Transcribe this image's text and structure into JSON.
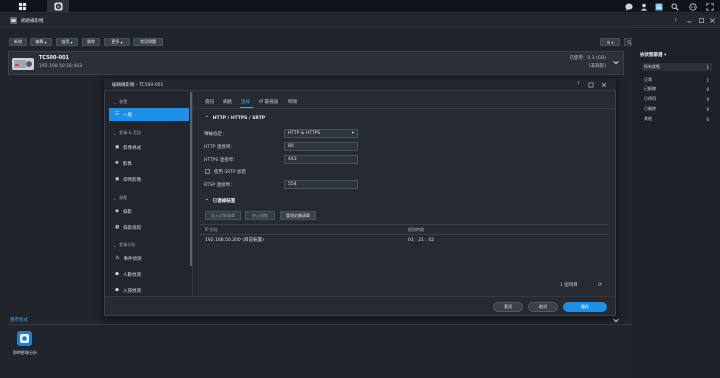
{
  "window": {
    "title": "網路攝影機"
  },
  "toolbar": {
    "buttons": [
      "新增",
      "編輯",
      "啟用",
      "刪除",
      "更多",
      "常見問題"
    ],
    "search_placeholder": "搜尋"
  },
  "camera": {
    "name": "TC500-001",
    "address": "192.168.50.16:443",
    "usage": "已使用：0.3 (GB)",
    "mode": "[非錄影]"
  },
  "right_panel": {
    "title": "依狀態篩選",
    "items": [
      {
        "label": "所有狀態",
        "count": "1"
      },
      {
        "label": "正常",
        "count": "1"
      },
      {
        "label": "已斷線",
        "count": "0"
      },
      {
        "label": "已停用",
        "count": "0"
      },
      {
        "label": "已刪除",
        "count": "0"
      },
      {
        "label": "其他",
        "count": "0"
      }
    ]
  },
  "apps": {
    "section_title": "應用程式",
    "app_label": "即時影像分析"
  },
  "dialog": {
    "title": "編輯攝影機 - TC500-001",
    "sidebar": {
      "cat1": "裝置",
      "item_general": "一般",
      "cat2": "影像 & 音訊",
      "item_format": "影像格式",
      "item_image": "影像",
      "item_live": "即時影像",
      "cat3": "錄影",
      "item_record": "錄影",
      "item_schedule": "錄影排程",
      "cat4": "影像分析",
      "item_event": "事件偵測",
      "item_people": "人數偵測",
      "item_intrusion": "入侵偵測"
    },
    "tabs": [
      "資訊",
      "網路",
      "連線",
      "IP 篩選器",
      "時間"
    ],
    "active_tab": "連線",
    "section1": "HTTP / HTTPS / SRTP",
    "fields": {
      "protocol_label": "傳輸協定：",
      "protocol_value": "HTTP & HTTPS",
      "http_label": "HTTP 連接埠：",
      "http_value": "80",
      "https_label": "HTTPS 連接埠：",
      "https_value": "443",
      "srtp_label": "使用 SRTP 加密",
      "rtsp_label": "RTSP 連接埠：",
      "rtsp_value": "554"
    },
    "section2": "已連線裝置",
    "grid_buttons": [
      "加入封鎖清單",
      "終止連線",
      "管理封鎖清單"
    ],
    "table": {
      "col_ip": "IP 位址",
      "col_time": "經過時間",
      "rows": [
        {
          "ip": "192.168.50.200 (目前裝置)",
          "time": "01 : 21 : 42"
        }
      ]
    },
    "count": "1 個項目",
    "footer": {
      "apply": "套用",
      "cancel": "取消",
      "save": "儲存"
    }
  },
  "colors": {
    "accent": "#1d8fe6",
    "background": "#1b1e24",
    "dialog": "#262a31"
  }
}
